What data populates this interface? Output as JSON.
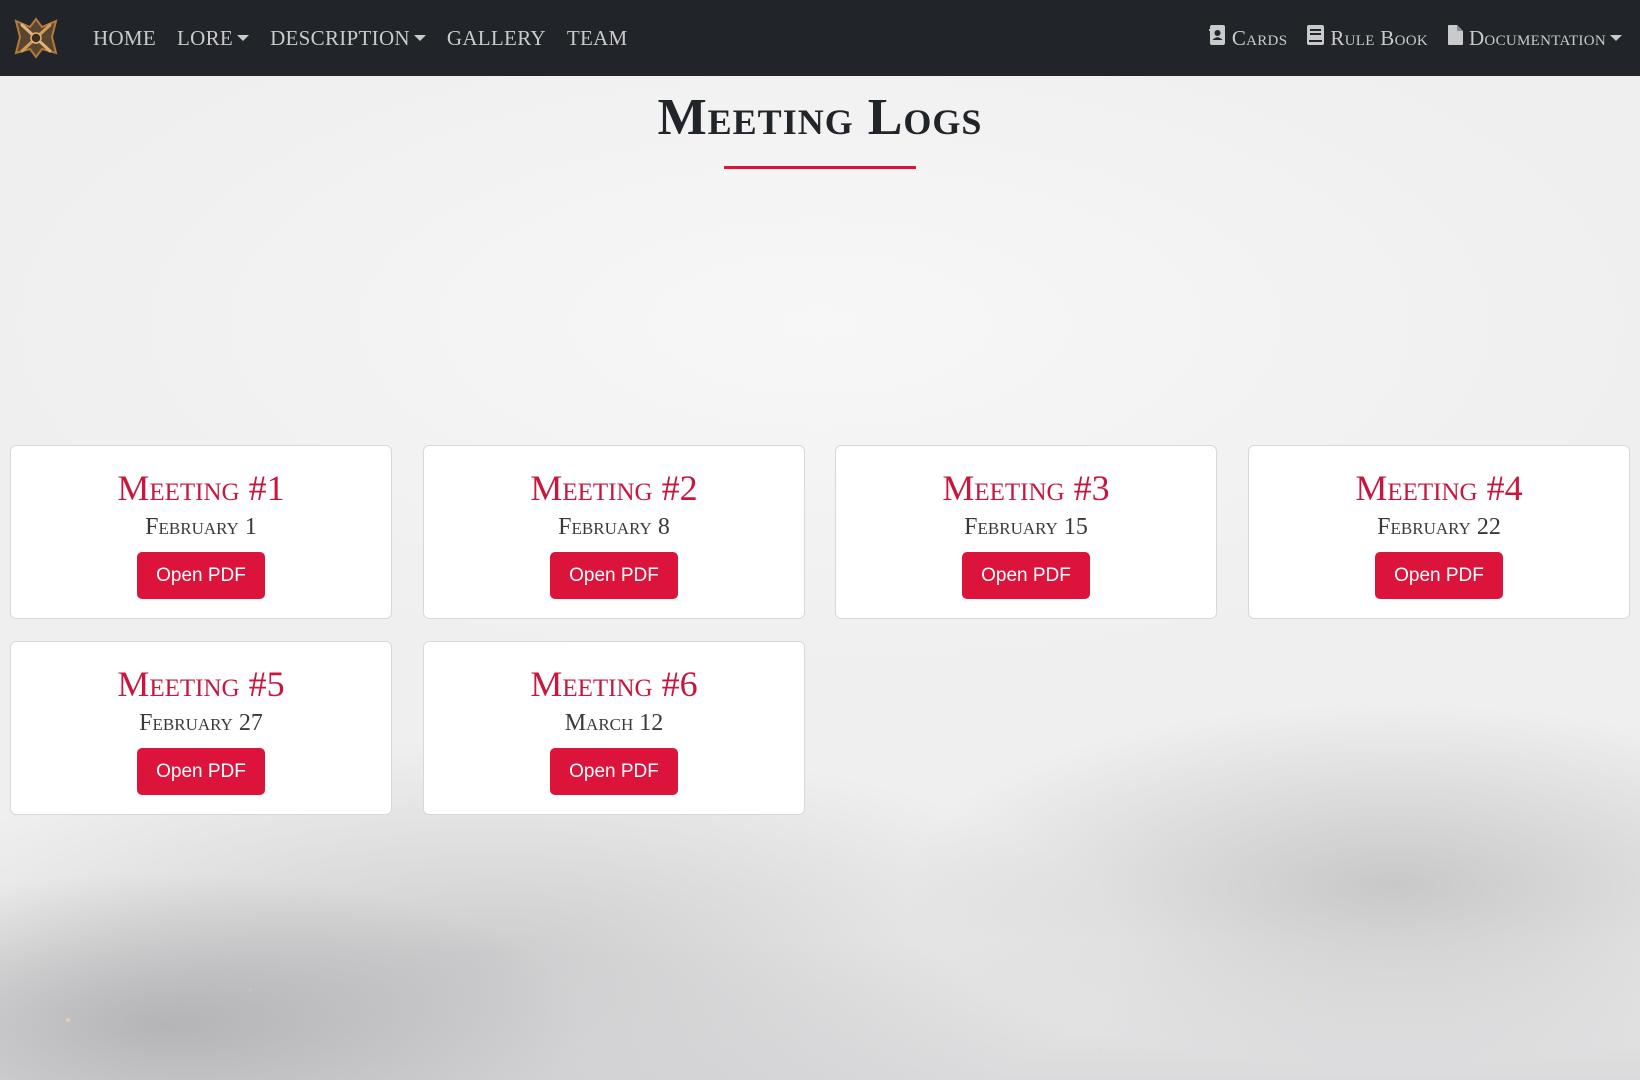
{
  "nav": {
    "brand_icon": "crossed-swords-emblem-icon",
    "left_items": [
      {
        "label": "HOME",
        "dropdown": false
      },
      {
        "label": "LORE",
        "dropdown": true
      },
      {
        "label": "DESCRIPTION",
        "dropdown": true
      },
      {
        "label": "GALLERY",
        "dropdown": false
      },
      {
        "label": "TEAM",
        "dropdown": false
      }
    ],
    "right_items": [
      {
        "label": "Cards",
        "icon": "contact-card-icon",
        "dropdown": false
      },
      {
        "label": "Rule Book",
        "icon": "book-icon",
        "dropdown": false
      },
      {
        "label": "Documentation",
        "icon": "file-icon",
        "dropdown": true
      }
    ]
  },
  "page": {
    "title": "Meeting Logs"
  },
  "meetings": [
    {
      "title": "Meeting #1",
      "date": "February 1",
      "button": "Open PDF"
    },
    {
      "title": "Meeting #2",
      "date": "February 8",
      "button": "Open PDF"
    },
    {
      "title": "Meeting #3",
      "date": "February 15",
      "button": "Open PDF"
    },
    {
      "title": "Meeting #4",
      "date": "February 22",
      "button": "Open PDF"
    },
    {
      "title": "Meeting #5",
      "date": "February 27",
      "button": "Open PDF"
    },
    {
      "title": "Meeting #6",
      "date": "March 12",
      "button": "Open PDF"
    }
  ],
  "colors": {
    "navbar_bg": "#212529",
    "accent": "#dc143c",
    "nav_text": "#c9cacc"
  }
}
